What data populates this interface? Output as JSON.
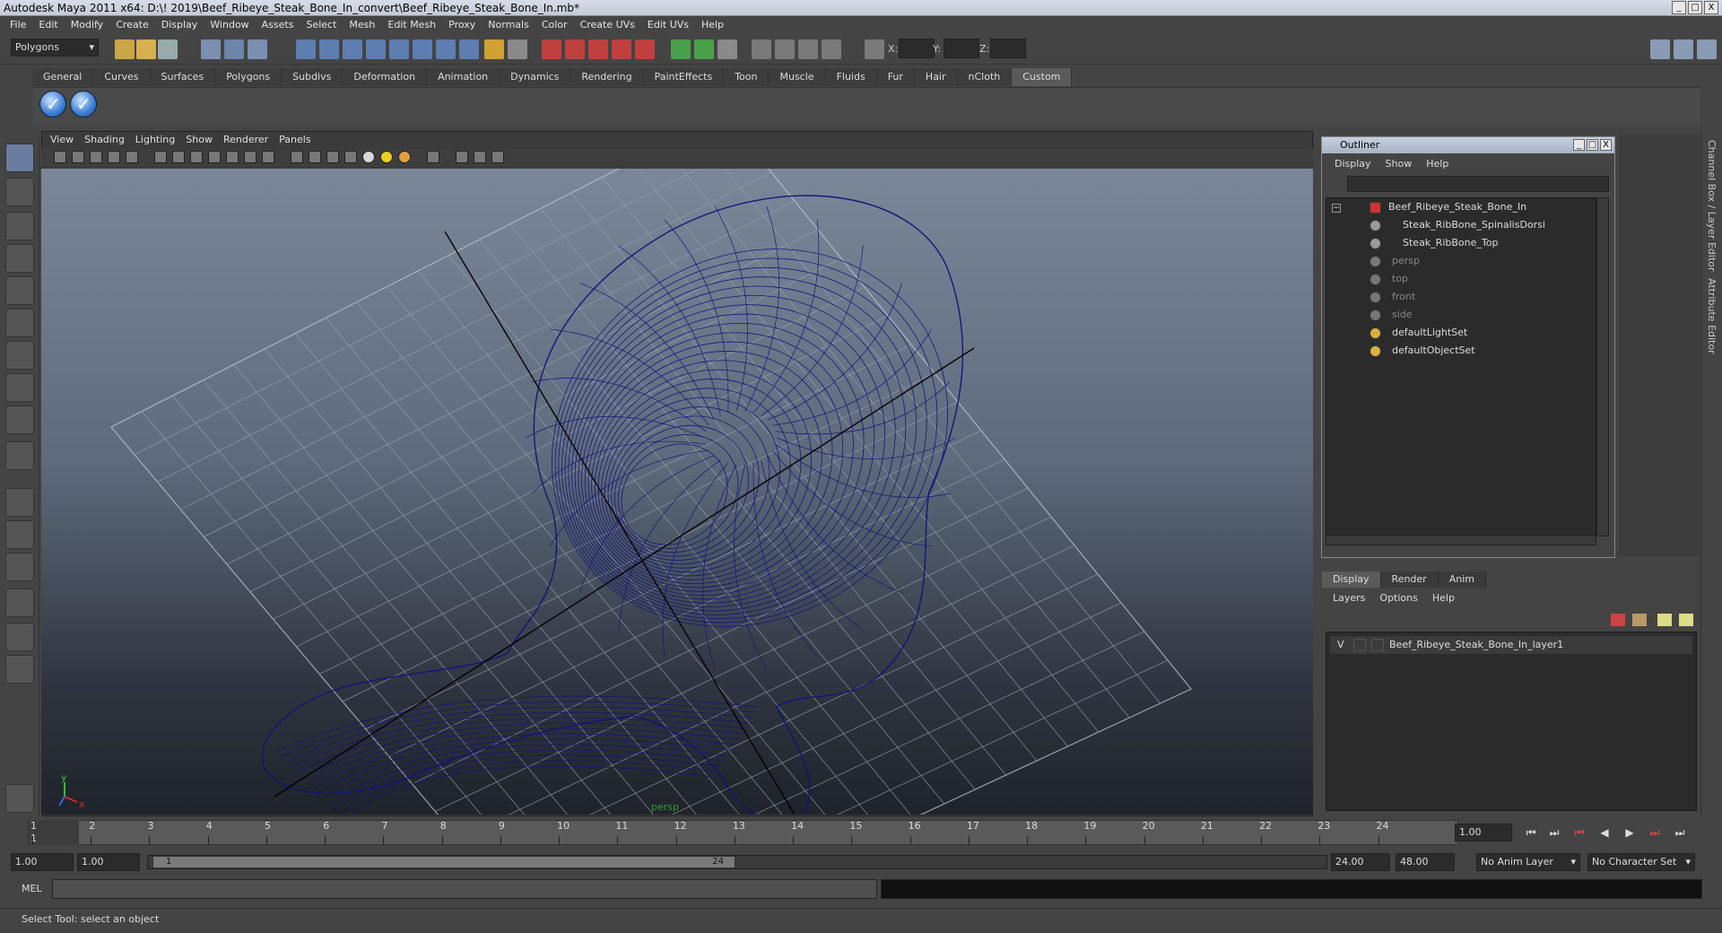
{
  "window": {
    "title": "Autodesk Maya 2011 x64: D:\\! 2019\\Beef_Ribeye_Steak_Bone_In_convert\\Beef_Ribeye_Steak_Bone_In.mb*",
    "btn_min": "_",
    "btn_max": "□",
    "btn_close": "X"
  },
  "menubar": [
    "File",
    "Edit",
    "Modify",
    "Create",
    "Display",
    "Window",
    "Assets",
    "Select",
    "Mesh",
    "Edit Mesh",
    "Proxy",
    "Normals",
    "Color",
    "Create UVs",
    "Edit UVs",
    "Help"
  ],
  "statusline": {
    "mode": "Polygons",
    "x_label": "X:",
    "y_label": "Y:",
    "z_label": "Z:"
  },
  "shelf_tabs": [
    "General",
    "Curves",
    "Surfaces",
    "Polygons",
    "Subdivs",
    "Deformation",
    "Animation",
    "Dynamics",
    "Rendering",
    "PaintEffects",
    "Toon",
    "Muscle",
    "Fluids",
    "Fur",
    "Hair",
    "nCloth",
    "Custom"
  ],
  "viewport": {
    "menu": [
      "View",
      "Shading",
      "Lighting",
      "Show",
      "Renderer",
      "Panels"
    ],
    "camera_label": "persp",
    "axis_x": "x",
    "axis_y": "y"
  },
  "outliner": {
    "title": "Outliner",
    "menu": [
      "Display",
      "Show",
      "Help"
    ],
    "items": [
      {
        "label": "Beef_Ribeye_Steak_Bone_In"
      },
      {
        "label": "Steak_RibBone_SpinalisDorsi"
      },
      {
        "label": "Steak_RibBone_Top"
      },
      {
        "label": "persp"
      },
      {
        "label": "top"
      },
      {
        "label": "front"
      },
      {
        "label": "side"
      },
      {
        "label": "defaultLightSet"
      },
      {
        "label": "defaultObjectSet"
      }
    ],
    "collapse_toggle": "−"
  },
  "side_labels": {
    "channel_box": "Channel Box / Layer Editor",
    "attribute_editor": "Attribute Editor"
  },
  "layers": {
    "tabs": [
      "Display",
      "Render",
      "Anim"
    ],
    "menu": [
      "Layers",
      "Options",
      "Help"
    ],
    "rows": [
      {
        "visible": "V",
        "name": "Beef_Ribeye_Steak_Bone_In_layer1"
      }
    ]
  },
  "timeslider": {
    "frames": [
      "1",
      "2",
      "3",
      "4",
      "5",
      "6",
      "7",
      "8",
      "9",
      "10",
      "11",
      "12",
      "13",
      "14",
      "15",
      "16",
      "17",
      "18",
      "19",
      "20",
      "21",
      "22",
      "23",
      "24"
    ],
    "current_frame_label": "1",
    "current_time": "1.00",
    "controls": [
      "⏮",
      "⏭",
      "⏮",
      "◀",
      "▶",
      "⏭",
      "⏭"
    ]
  },
  "rangeslider": {
    "start_time": "1.00",
    "range_start": "1.00",
    "handle_start": "1",
    "handle_end": "24",
    "range_end": "24.00",
    "end_time": "48.00",
    "anim_layer": "No Anim Layer",
    "character_set": "No Character Set"
  },
  "cmdline": {
    "label": "MEL"
  },
  "helpline": {
    "text": "Select Tool: select an object"
  }
}
